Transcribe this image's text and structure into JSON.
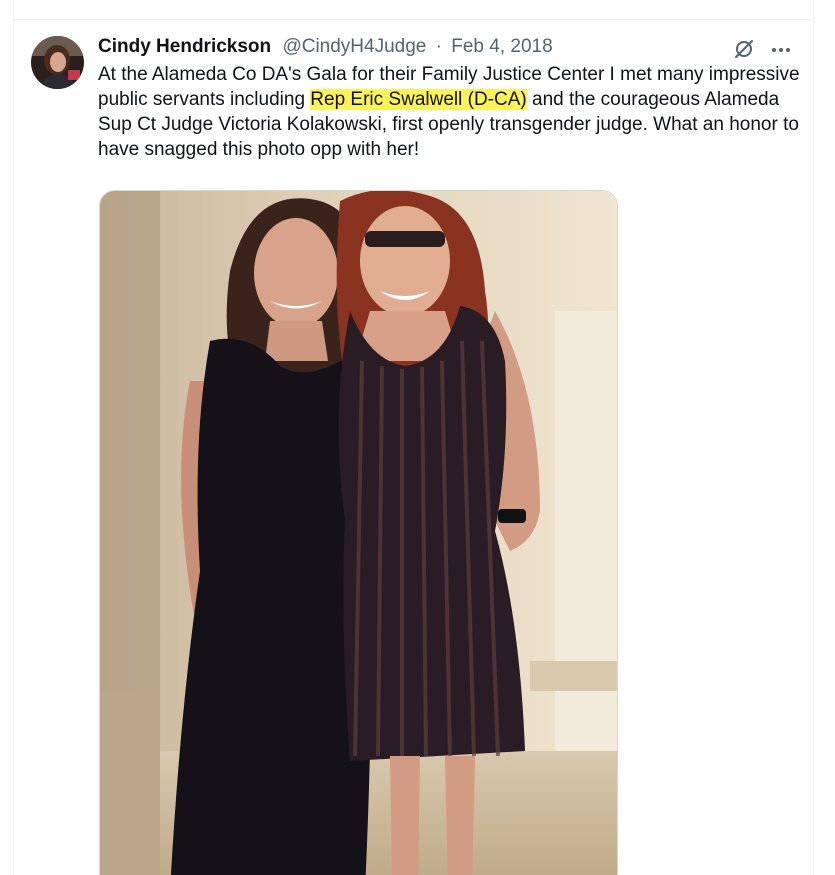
{
  "tweet": {
    "author_name": "Cindy Hendrickson",
    "handle": "@CindyH4Judge",
    "separator": "·",
    "date": "Feb 4, 2018",
    "text_before": "At the Alameda Co DA's Gala for their Family Justice Center I met many impressive public servants including ",
    "text_highlight": "Rep Eric Swalwell (D-CA)",
    "text_after": " and the courageous Alameda Sup Ct Judge Victoria Kolakowski, first openly transgender judge. What an honor to have snagged this photo opp with her!",
    "highlight_color": "#fdf25a"
  },
  "icons": {
    "avatar": "avatar",
    "grok": "grok-icon",
    "more": "more-icon"
  },
  "colors": {
    "text": "#0f1419",
    "secondary": "#536471",
    "border": "#eff3f4"
  }
}
